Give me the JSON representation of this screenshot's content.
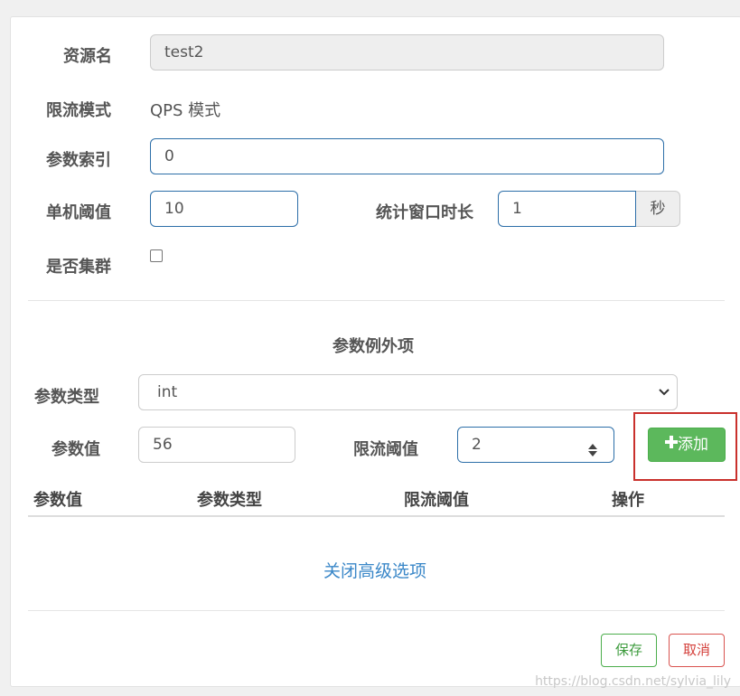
{
  "form": {
    "resource_label": "资源名",
    "resource_value": "test2",
    "mode_label": "限流模式",
    "mode_value": "QPS 模式",
    "param_index_label": "参数索引",
    "param_index_value": "0",
    "threshold_label": "单机阈值",
    "threshold_value": "10",
    "window_label": "统计窗口时长",
    "window_value": "1",
    "window_unit": "秒",
    "cluster_label": "是否集群",
    "cluster_checked": false
  },
  "exception": {
    "section_title": "参数例外项",
    "type_label": "参数类型",
    "type_selected": "int",
    "value_label": "参数值",
    "value_input": "56",
    "limit_label": "限流阈值",
    "limit_input": "2",
    "add_button": "添加",
    "table_headers": [
      "参数值",
      "参数类型",
      "限流阈值",
      "操作"
    ]
  },
  "advanced_link": "关闭高级选项",
  "footer": {
    "save_button": "保存",
    "cancel_button": "取消"
  },
  "watermark": "https://blog.csdn.net/sylvia_lily",
  "icons": {
    "plus": "plus-icon",
    "dropdown": "chevron-down-icon",
    "spinner": "spin-arrows-icon"
  },
  "colors": {
    "primary_border": "#2c6ea8",
    "add_button": "#5cb85c",
    "save_border": "#4cae4c",
    "cancel_border": "#d9534f",
    "link": "#3a87c8",
    "highlight": "#c9302c"
  }
}
